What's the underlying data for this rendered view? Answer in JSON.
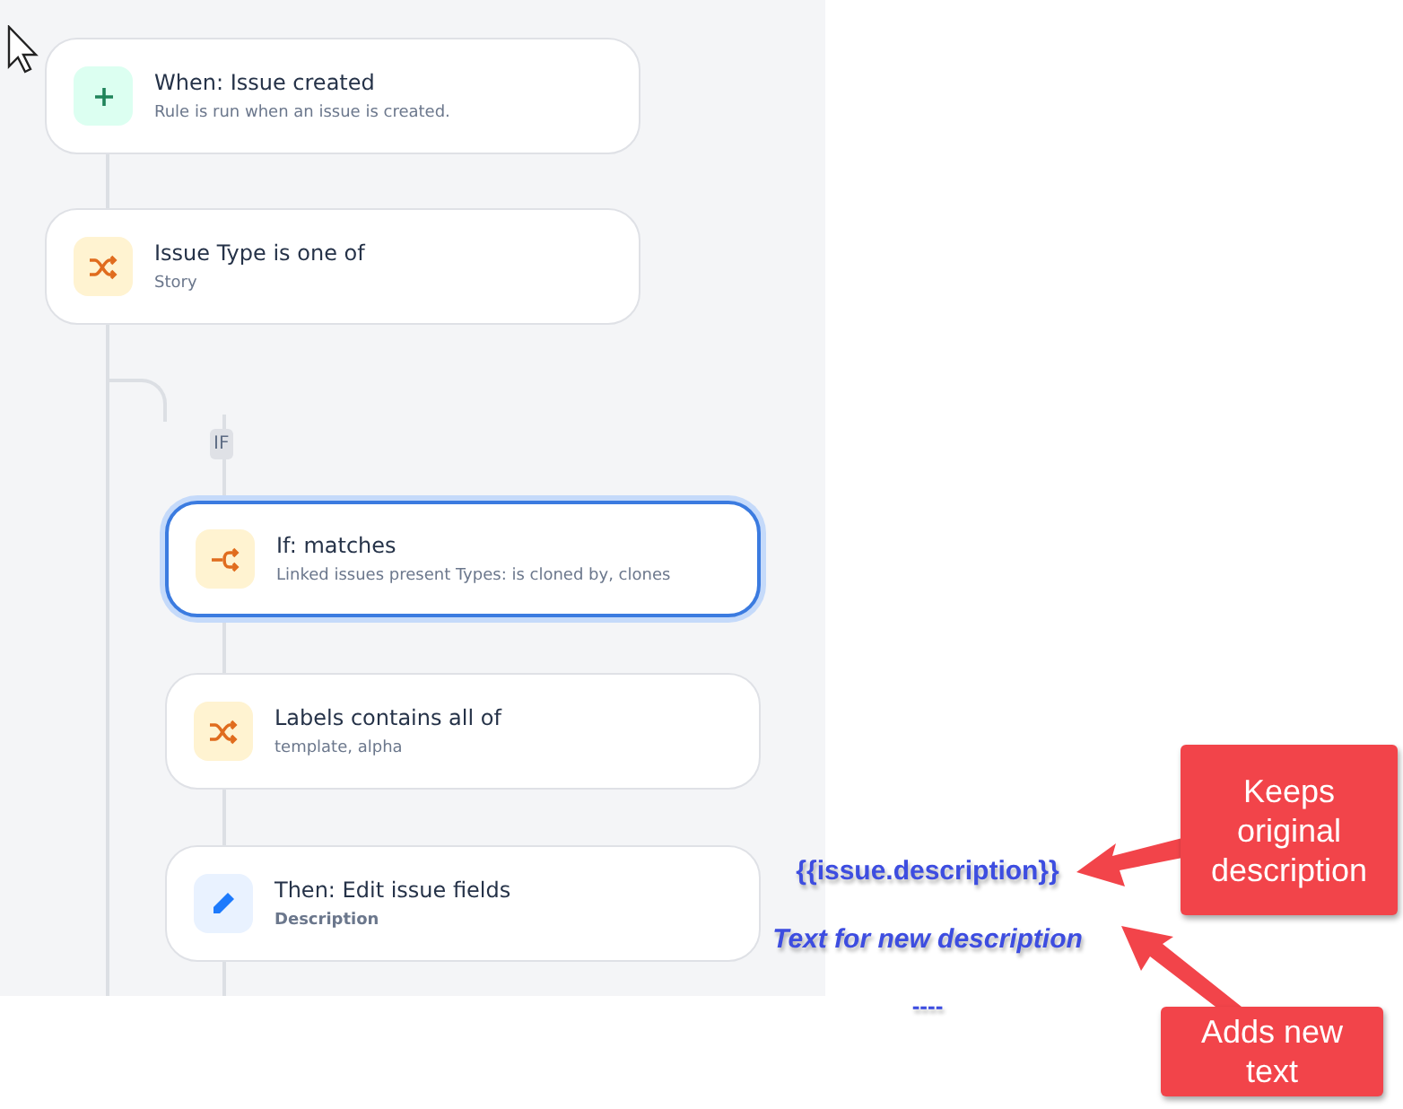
{
  "steps": [
    {
      "kind": "trigger",
      "title": "When: Issue created",
      "subtitle": "Rule is run when an issue is created.",
      "selected": false
    },
    {
      "kind": "condition",
      "title": "Issue Type is one of",
      "subtitle": "Story",
      "selected": false
    }
  ],
  "branch": {
    "label": "IF",
    "steps": [
      {
        "kind": "branch-condition",
        "title": "If: matches",
        "subtitle": "Linked issues present Types: is cloned by, clones",
        "selected": true
      },
      {
        "kind": "condition",
        "title": "Labels contains all of",
        "subtitle": "template, alpha",
        "selected": false
      },
      {
        "kind": "action",
        "title": "Then: Edit issue fields",
        "subtitle": "Description",
        "selected": false
      }
    ]
  },
  "description_lines": [
    {
      "kind": "code",
      "text": "{{issue.description}}"
    },
    {
      "kind": "text",
      "text": "Text for new description"
    },
    {
      "kind": "rule",
      "text": "----"
    }
  ],
  "callouts": [
    {
      "text": "Keeps original description"
    },
    {
      "text": "Adds new text"
    }
  ]
}
